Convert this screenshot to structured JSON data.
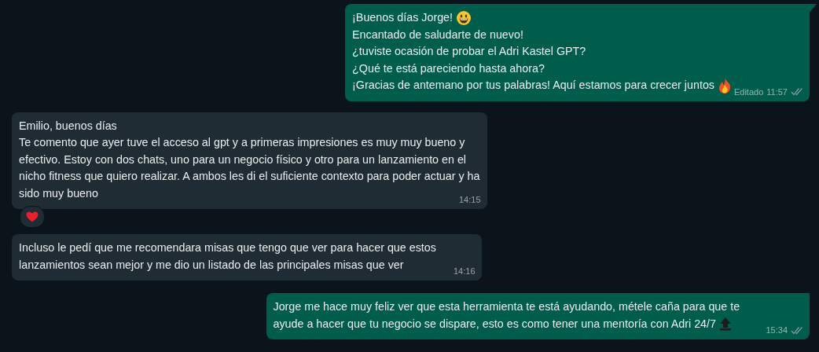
{
  "messages": [
    {
      "kind": "outgoing",
      "lines": [
        {
          "text": "¡Buenos días Jorge!",
          "emoji": {
            "kind": "smiley"
          }
        },
        {
          "text": "Encantado de saludarte de nuevo!"
        },
        {
          "text": "¿tuviste ocasión de probar el Adri Kastel GPT?"
        },
        {
          "text": "¿Qué te está pareciendo hasta ahora?"
        },
        {
          "text": "¡Gracias de antemano por tus palabras! Aquí estamos para crecer juntos",
          "emoji": {
            "kind": "fire"
          }
        }
      ],
      "edited": "Editado",
      "time": "11:57",
      "read": false
    },
    {
      "kind": "incoming",
      "lines": [
        {
          "text": "Emilio, buenos días"
        },
        {
          "text": "Te comento que ayer tuve el acceso al gpt y a primeras impresiones es muy muy bueno y"
        },
        {
          "text": "efectivo. Estoy con dos chats, uno para un negocio físico y otro para un lanzamiento en el"
        },
        {
          "text": "nicho fitness que quiero realizar. A ambos les di el suficiente contexto para poder actuar y ha"
        },
        {
          "text": "sido muy bueno"
        }
      ],
      "time": "14:15",
      "reaction": {
        "kind": "heart"
      }
    },
    {
      "kind": "incoming",
      "lines": [
        {
          "text": "Incluso le pedí que me recomendara misas que tengo que ver para hacer que estos"
        },
        {
          "text": "lanzamientos sean mejor y me dio un listado de las principales misas que ver"
        }
      ],
      "time": "14:16"
    },
    {
      "kind": "outgoing",
      "lines": [
        {
          "text": "Jorge me hace muy feliz ver que esta herramienta te está ayudando, métele caña para que te"
        },
        {
          "text": "ayude a hacer que tu negocio se dispare, esto es como tener una mentoría con Adri 24/7",
          "emoji": {
            "kind": "top"
          }
        }
      ],
      "time": "15:34",
      "read": false
    }
  ]
}
